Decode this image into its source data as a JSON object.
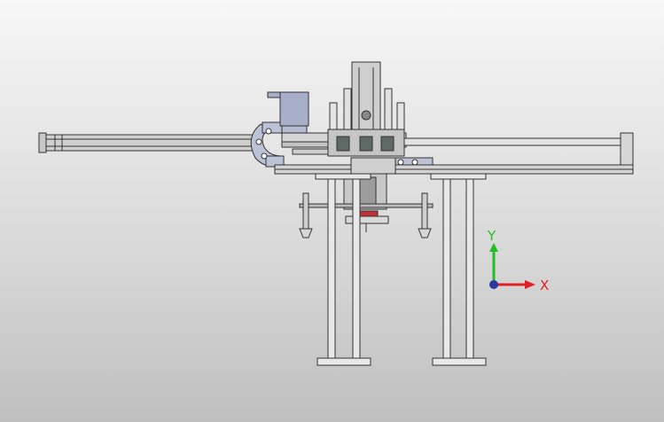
{
  "viewport": {
    "background_top": "#f7f7f7",
    "background_bottom": "#bfbfbf"
  },
  "triad": {
    "x_label": "X",
    "y_label": "Y",
    "x_color": "#e02020",
    "y_color": "#20c020",
    "origin_color": "#2a3aa0"
  },
  "model": {
    "steel_color": "#d6d6d6",
    "edge_color": "#333333",
    "motor_color": "#a7aec8",
    "chain_color": "#bcc3d6",
    "accent_color": "#c03030"
  }
}
